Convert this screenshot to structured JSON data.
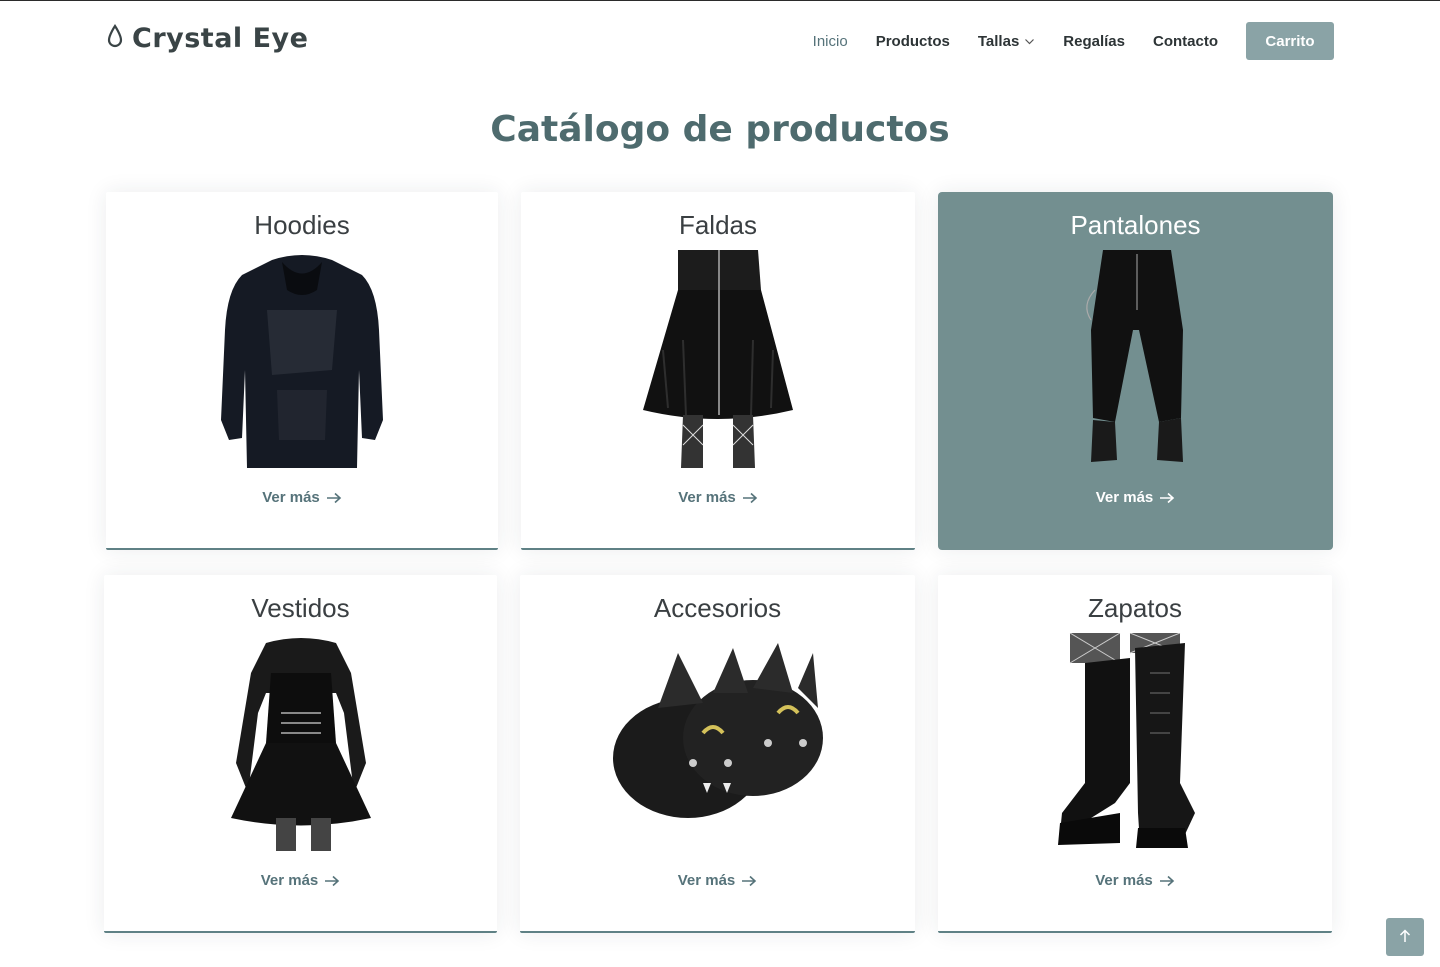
{
  "brand": {
    "name": "Crystal Eye",
    "icon": "drop-icon"
  },
  "nav": {
    "items": [
      {
        "label": "Inicio",
        "active": true
      },
      {
        "label": "Productos",
        "active": false
      },
      {
        "label": "Tallas",
        "active": false,
        "dropdown": true
      },
      {
        "label": "Regalías",
        "active": false
      },
      {
        "label": "Contacto",
        "active": false
      }
    ],
    "cart_label": "Carrito"
  },
  "page": {
    "title": "Catálogo de productos"
  },
  "categories": [
    {
      "title": "Hoodies",
      "link": "Ver más",
      "image": "hoodie-image"
    },
    {
      "title": "Faldas",
      "link": "Ver más",
      "image": "skirt-image"
    },
    {
      "title": "Pantalones",
      "link": "Ver más",
      "image": "pants-image",
      "highlighted": true
    },
    {
      "title": "Vestidos",
      "link": "Ver más",
      "image": "dress-image"
    },
    {
      "title": "Accesorios",
      "link": "Ver más",
      "image": "bat-slippers-image"
    },
    {
      "title": "Zapatos",
      "link": "Ver más",
      "image": "boots-image"
    }
  ],
  "colors": {
    "accent": "#56737a",
    "title": "#4e6b6e",
    "button": "#8aa3a6",
    "highlight_card": "#738f90"
  },
  "back_to_top_icon": "arrow-up-icon"
}
